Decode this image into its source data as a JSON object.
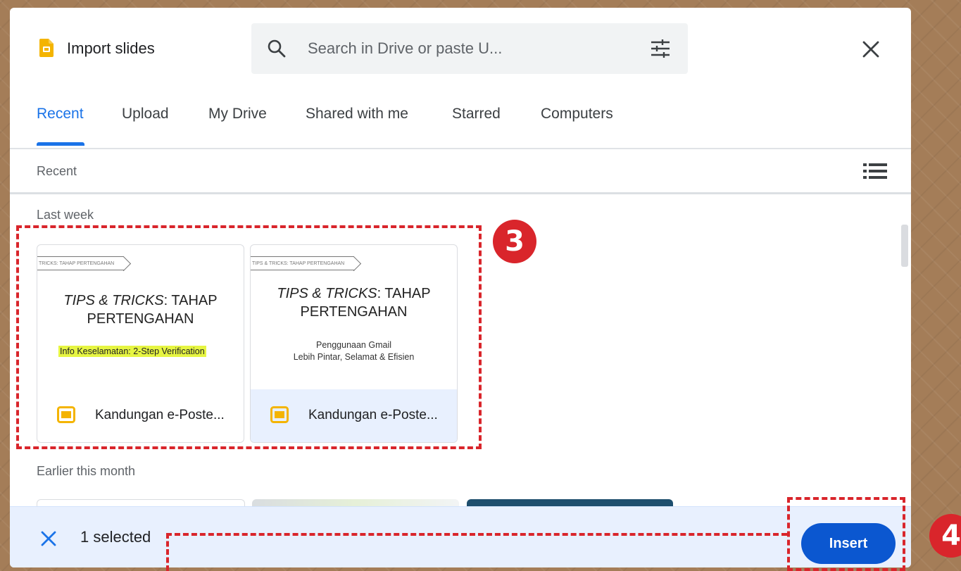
{
  "dialog": {
    "title": "Import slides",
    "search_placeholder": "Search in Drive or paste U...",
    "tabs": [
      {
        "label": "Recent",
        "active": true
      },
      {
        "label": "Upload",
        "active": false
      },
      {
        "label": "My Drive",
        "active": false
      },
      {
        "label": "Shared with me",
        "active": false
      },
      {
        "label": "Starred",
        "active": false
      },
      {
        "label": "Computers",
        "active": false
      }
    ],
    "breadcrumb": "Recent",
    "sections": {
      "last_week": "Last week",
      "earlier": "Earlier this month"
    },
    "files": [
      {
        "name": "Kandungan e-Poste...",
        "slide_ribbon": "TRICKS: TAHAP PERTENGAHAN",
        "slide_title_italic": "TIPS & TRICKS",
        "slide_title_rest": ": TAHAP",
        "slide_title_line2": "PERTENGAHAN",
        "slide_sub": "Info Keselamatan: 2-Step Verification",
        "selected": false
      },
      {
        "name": "Kandungan e-Poste...",
        "slide_ribbon": "TIPS & TRICKS: TAHAP PERTENGAHAN",
        "slide_title_italic": "TIPS & TRICKS",
        "slide_title_rest": ": TAHAP",
        "slide_title_line2": "PERTENGAHAN",
        "slide_sub_line1": "Penggunaan Gmail",
        "slide_sub_line2": "Lebih Pintar, Selamat & Efisien",
        "selected": true
      }
    ],
    "footer": {
      "selected_text": "1 selected",
      "insert_label": "Insert"
    }
  },
  "annotations": {
    "step3": "3",
    "step4": "4"
  },
  "colors": {
    "accent": "#1a73e8",
    "insert_button": "#0b57d0",
    "selection_bg": "#e8f0fe",
    "annotation_red": "#d9252b",
    "slides_yellow": "#f4b400"
  },
  "icons": [
    "slides-app-icon",
    "search-icon",
    "filter-icon",
    "close-icon",
    "list-view-icon",
    "slides-file-icon",
    "deselect-icon"
  ]
}
